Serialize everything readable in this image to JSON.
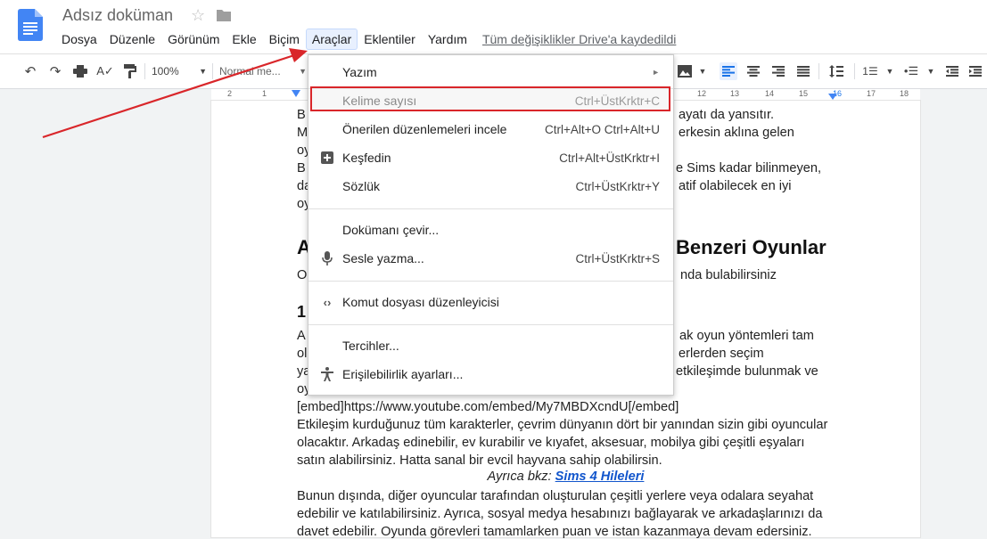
{
  "app": {
    "title": "Adsız doküman",
    "saved_status": "Tüm değişiklikler Drive'a kaydedildi"
  },
  "menubar": {
    "items": [
      "Dosya",
      "Düzenle",
      "Görünüm",
      "Ekle",
      "Biçim",
      "Araçlar",
      "Eklentiler",
      "Yardım"
    ],
    "active": "Araçlar"
  },
  "toolbar": {
    "zoom": "100%",
    "style": "Normal me..."
  },
  "ruler": {
    "numbers": [
      "2",
      "1",
      "12",
      "13",
      "14",
      "15",
      "16",
      "17",
      "18"
    ]
  },
  "dropdown": {
    "items": [
      {
        "label": "Yazım",
        "shortcut": "",
        "icon": "",
        "submenu": true
      },
      {
        "label": "Kelime sayısı",
        "shortcut": "Ctrl+ÜstKrktr+C",
        "icon": "",
        "highlighted": true
      },
      {
        "label": "Önerilen düzenlemeleri incele",
        "shortcut": "Ctrl+Alt+O Ctrl+Alt+U",
        "icon": ""
      },
      {
        "label": "Keşfedin",
        "shortcut": "Ctrl+Alt+ÜstKrktr+I",
        "icon": "explore-icon"
      },
      {
        "label": "Sözlük",
        "shortcut": "Ctrl+ÜstKrktr+Y",
        "icon": ""
      },
      {
        "label": "Dokümanı çevir...",
        "shortcut": "",
        "icon": ""
      },
      {
        "label": "Sesle yazma...",
        "shortcut": "Ctrl+ÜstKrktr+S",
        "icon": "microphone-icon"
      },
      {
        "label": "Komut dosyası düzenleyicisi",
        "shortcut": "",
        "icon": "code-icon"
      },
      {
        "label": "Tercihler...",
        "shortcut": "",
        "icon": ""
      },
      {
        "label": "Erişilebilirlik ayarları...",
        "shortcut": "",
        "icon": "accessibility-icon"
      }
    ]
  },
  "document": {
    "lines_top": [
      {
        "left": "B",
        "right": "ayatı da yansıtır."
      },
      {
        "left": "M",
        "right": "erkesin aklına gelen"
      },
      {
        "left": "oy",
        "right": ""
      },
      {
        "left": "B",
        "right": "e Sims kadar bilinmeyen,"
      },
      {
        "left": "da",
        "right": "atif olabilecek en iyi"
      },
      {
        "left": "oy",
        "right": ""
      }
    ],
    "heading_left": "A",
    "heading_right": "Benzeri Oyunlar",
    "sub_left": "O",
    "sub_right": "nda bulabilirsiniz",
    "h3_left": "1",
    "lines_mid": [
      {
        "left": "A",
        "right": "ak oyun yöntemleri tam"
      },
      {
        "left": "ol",
        "right": "erlerden seçim"
      },
      {
        "left": "ya",
        "right": "etkileşimde bulunmak ve"
      },
      {
        "left": "oy",
        "right": ""
      }
    ],
    "lines_bottom": [
      "[embed]https://www.youtube.com/embed/My7MBDXcndU[/embed]",
      "Etkileşim kurduğunuz tüm karakterler, çevrim dünyanın dört bir yanından sizin gibi oyuncular",
      "olacaktır. Arkadaş edinebilir, ev kurabilir ve kıyafet, aksesuar, mobilya gibi çeşitli eşyaları",
      "satın alabilirsiniz. Hatta sanal bir evcil hayvana sahip olabilirsin."
    ],
    "also_prefix": "Ayrıca bkz: ",
    "also_link": "Sims 4 Hileleri",
    "lines_final": [
      "Bunun dışında, diğer oyuncular tarafından oluşturulan çeşitli yerlere veya odalara seyahat",
      "edebilir ve katılabilirsiniz. Ayrıca, sosyal medya hesabınızı bağlayarak ve arkadaşlarınızı da",
      "davet edebilir. Oyunda görevleri tamamlarken puan ve istan kazanmaya devam edersiniz."
    ]
  },
  "colors": {
    "annotation": "#d9262a",
    "accent": "#1a73e8"
  }
}
